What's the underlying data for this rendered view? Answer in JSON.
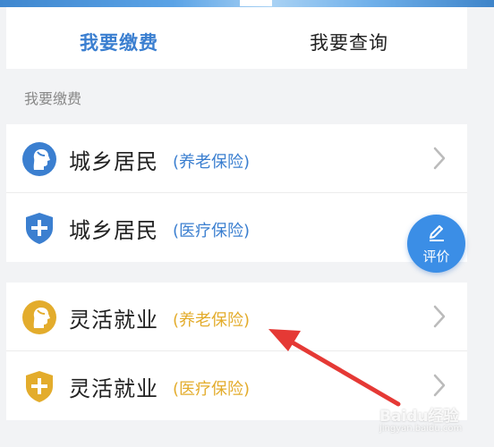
{
  "tabs": [
    {
      "label": "我要缴费",
      "active": true
    },
    {
      "label": "我要查询",
      "active": false
    }
  ],
  "section_title": "我要缴费",
  "items": [
    {
      "title": "城乡居民",
      "subtitle": "(养老保险)",
      "icon": "person-profile-icon",
      "color": "#3b7fd0"
    },
    {
      "title": "城乡居民",
      "subtitle": "(医疗保险)",
      "icon": "medical-shield-icon",
      "color": "#3b7fd0"
    },
    {
      "title": "灵活就业",
      "subtitle": "(养老保险)",
      "icon": "person-profile-icon",
      "color": "#e3ac2c"
    },
    {
      "title": "灵活就业",
      "subtitle": "(医疗保险)",
      "icon": "medical-shield-icon",
      "color": "#e3ac2c"
    }
  ],
  "fab": {
    "label": "评价",
    "icon": "pen-icon"
  },
  "watermark": {
    "text": "Baidu经验",
    "sub": "jingyan.baidu.com"
  },
  "colors": {
    "accent_blue": "#3b7fd0",
    "accent_gold": "#e3ac2c",
    "arrow_red": "#e53935"
  }
}
